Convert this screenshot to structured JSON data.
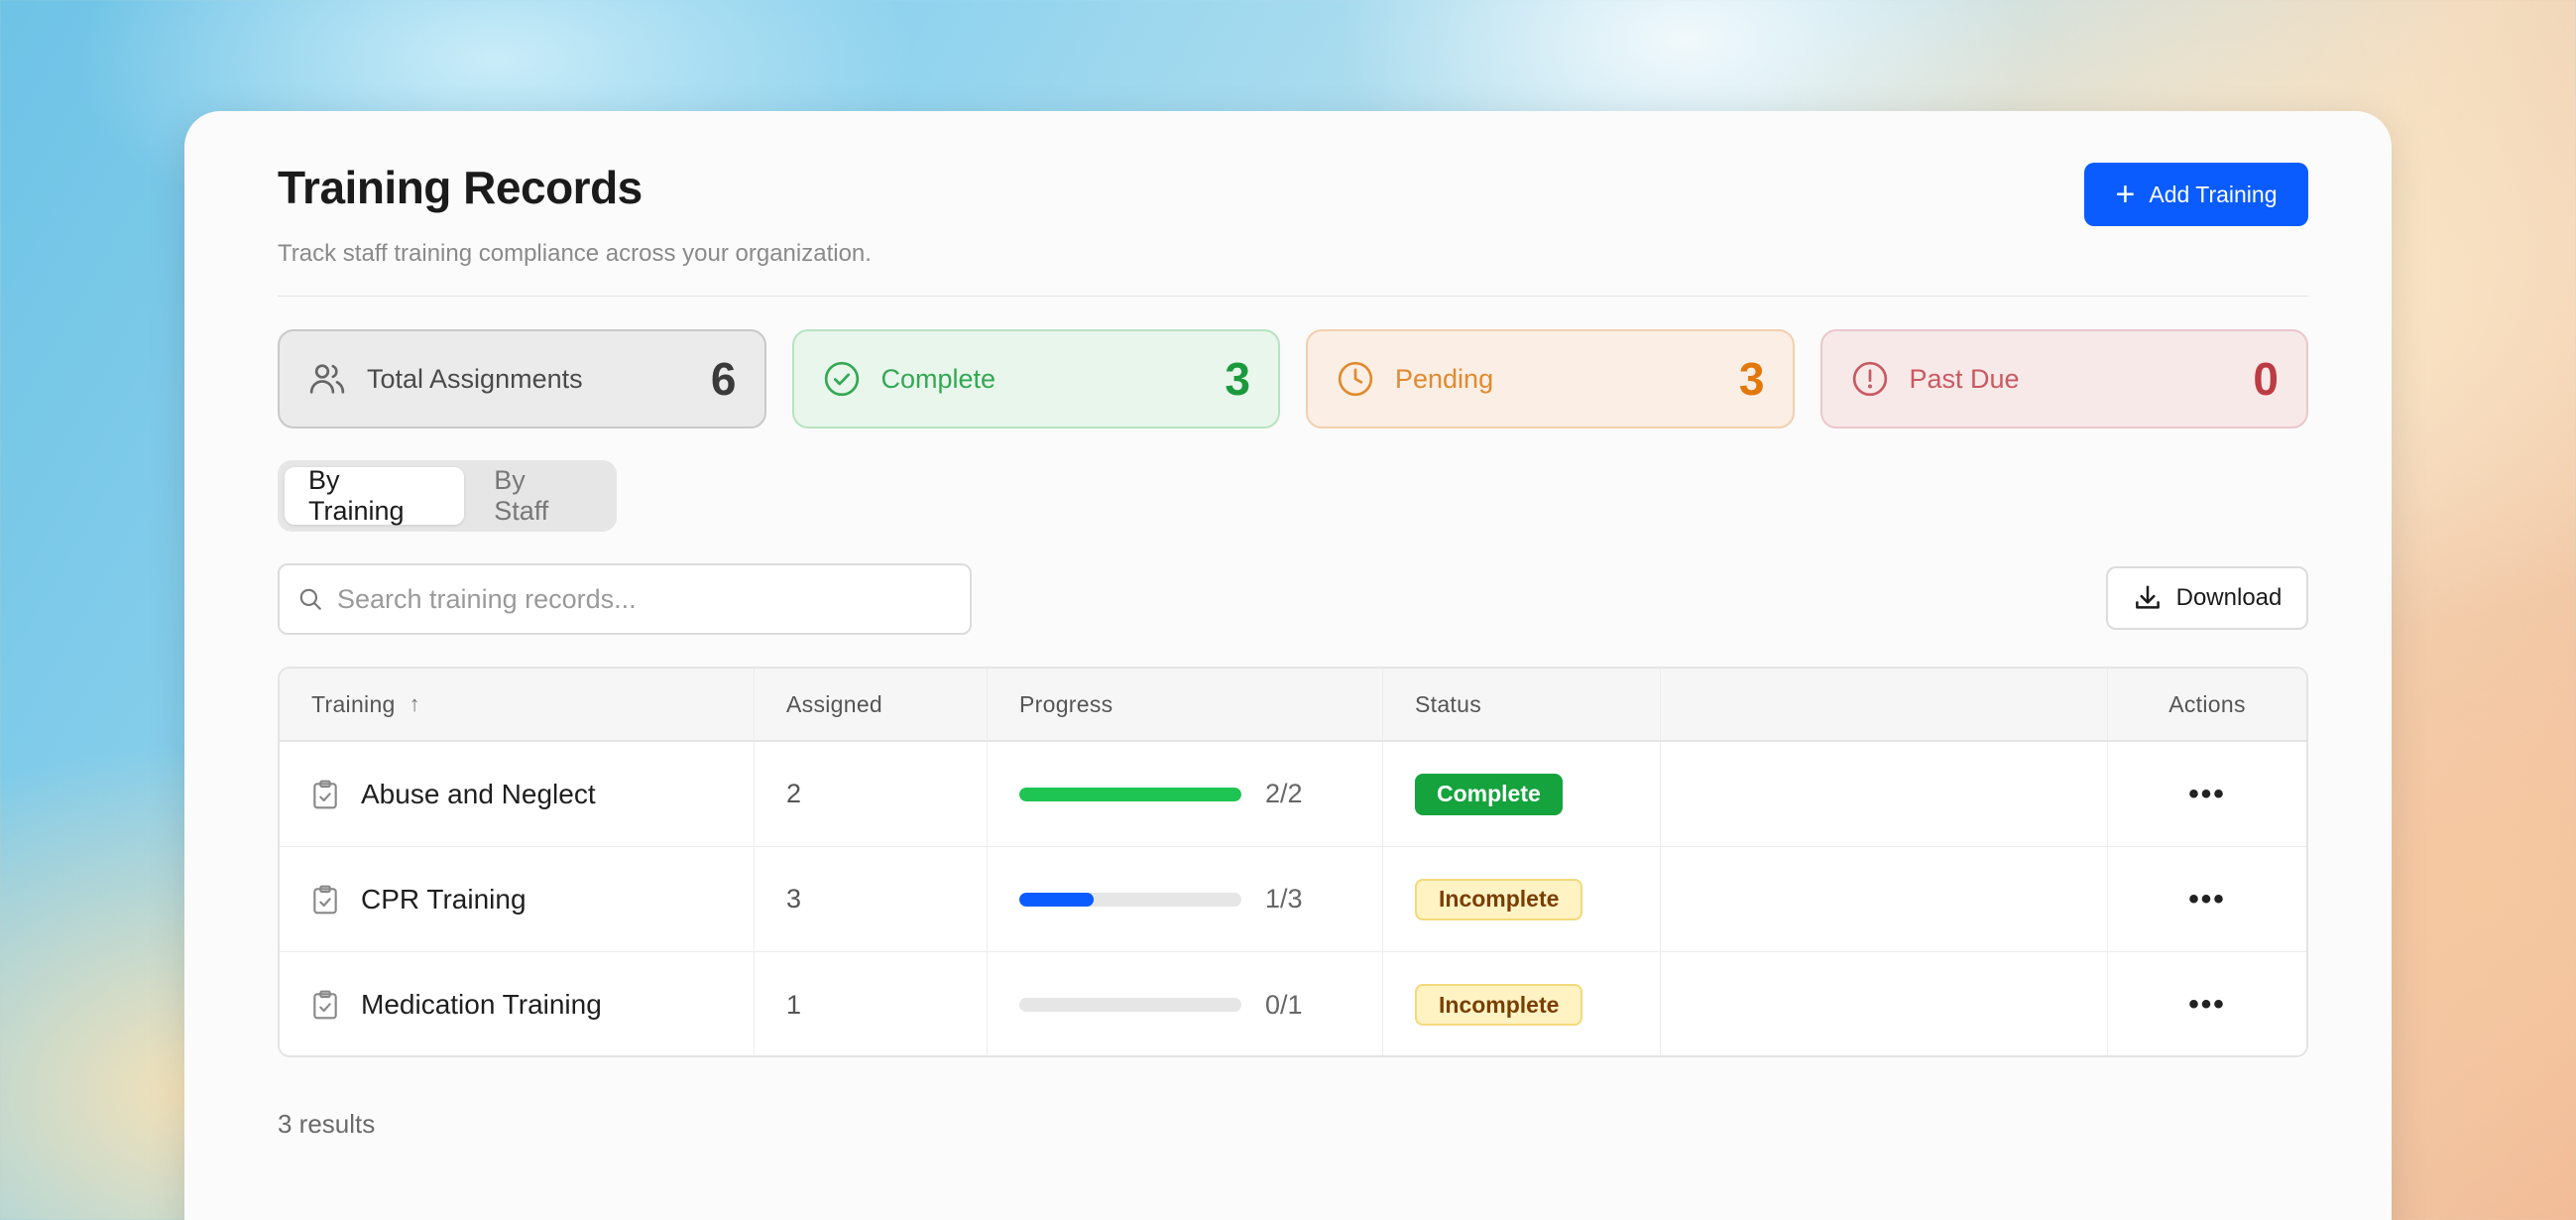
{
  "header": {
    "title": "Training Records",
    "subtitle": "Track staff training compliance across your organization.",
    "add_button_label": "Add Training"
  },
  "stats": [
    {
      "label": "Total Assignments",
      "value": "6",
      "icon": "users-icon"
    },
    {
      "label": "Complete",
      "value": "3",
      "icon": "check-circle-icon"
    },
    {
      "label": "Pending",
      "value": "3",
      "icon": "clock-icon"
    },
    {
      "label": "Past Due",
      "value": "0",
      "icon": "alert-circle-icon"
    }
  ],
  "view_toggle": {
    "options": [
      "By Training",
      "By Staff"
    ],
    "active": "By Training"
  },
  "search": {
    "placeholder": "Search training records..."
  },
  "download_label": "Download",
  "table": {
    "columns": [
      "Training",
      "Assigned",
      "Progress",
      "Status",
      "",
      "Actions"
    ],
    "sort": {
      "column": "Training",
      "direction": "ascending"
    },
    "rows": [
      {
        "training": "Abuse and Neglect",
        "assigned": "2",
        "progress_text": "2/2",
        "progress": 1.0,
        "status": "Complete"
      },
      {
        "training": "CPR Training",
        "assigned": "3",
        "progress_text": "1/3",
        "progress": 0.333,
        "status": "Incomplete"
      },
      {
        "training": "Medication Training",
        "assigned": "1",
        "progress_text": "0/1",
        "progress": 0.0,
        "status": "Incomplete"
      }
    ]
  },
  "results_text": "3 results",
  "colors": {
    "primary": "#0a5cff",
    "progress_complete": "#1ec552",
    "progress_partial": "#0a5cff",
    "badge_complete": "#15a33d",
    "badge_incomplete": "#fff3c4"
  }
}
